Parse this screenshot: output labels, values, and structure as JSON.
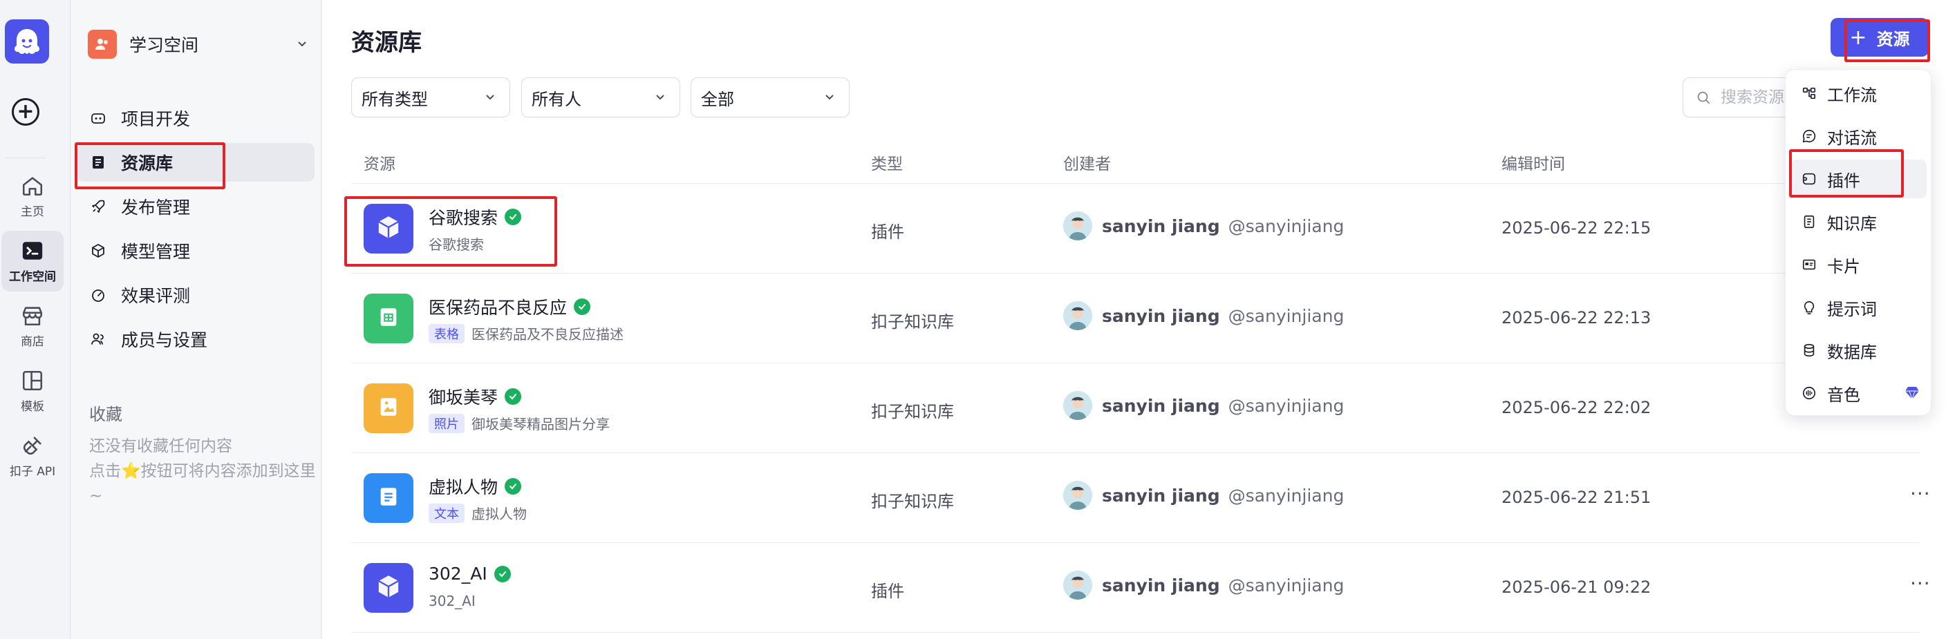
{
  "rail": {
    "items": [
      {
        "label": "主页",
        "icon": "home-icon"
      },
      {
        "label": "工作空间",
        "icon": "terminal-icon"
      },
      {
        "label": "商店",
        "icon": "store-icon"
      },
      {
        "label": "模板",
        "icon": "template-icon"
      },
      {
        "label": "扣子 API",
        "icon": "plug-icon"
      }
    ]
  },
  "sidebar": {
    "workspace": "学习空间",
    "nav": [
      {
        "label": "项目开发",
        "icon": "bot-icon"
      },
      {
        "label": "资源库",
        "icon": "library-icon"
      },
      {
        "label": "发布管理",
        "icon": "rocket-icon"
      },
      {
        "label": "模型管理",
        "icon": "cube-icon"
      },
      {
        "label": "效果评测",
        "icon": "gauge-icon"
      },
      {
        "label": "成员与设置",
        "icon": "members-icon"
      }
    ],
    "favorites_title": "收藏",
    "favorites_empty_1": "还没有收藏任何内容",
    "favorites_empty_2": "点击⭐按钮可将内容添加到这里~"
  },
  "main": {
    "title": "资源库",
    "add_button": "资源",
    "filters": [
      "所有类型",
      "所有人",
      "全部"
    ],
    "search_placeholder": "搜索资源",
    "columns": [
      "资源",
      "类型",
      "创建者",
      "编辑时间"
    ],
    "rows": [
      {
        "name": "谷歌搜索",
        "tag": "",
        "desc": "谷歌搜索",
        "type": "插件",
        "user": "sanyin jiang",
        "handle": "@sanyinjiang",
        "time": "2025-06-22 22:15",
        "color": "#4d53e8",
        "icon": "cube-icon"
      },
      {
        "name": "医保药品不良反应",
        "tag": "表格",
        "desc": "医保药品及不良反应描述",
        "type": "扣子知识库",
        "user": "sanyin jiang",
        "handle": "@sanyinjiang",
        "time": "2025-06-22 22:13",
        "color": "#38c172",
        "icon": "table-icon"
      },
      {
        "name": "御坂美琴",
        "tag": "照片",
        "desc": "御坂美琴精品图片分享",
        "type": "扣子知识库",
        "user": "sanyin jiang",
        "handle": "@sanyinjiang",
        "time": "2025-06-22 22:02",
        "color": "#f7b23b",
        "icon": "image-icon"
      },
      {
        "name": "虚拟人物",
        "tag": "文本",
        "desc": "虚拟人物",
        "type": "扣子知识库",
        "user": "sanyin jiang",
        "handle": "@sanyinjiang",
        "time": "2025-06-22 21:51",
        "color": "#2f8cf5",
        "icon": "document-icon"
      },
      {
        "name": "302_AI",
        "tag": "",
        "desc": "302_AI",
        "type": "插件",
        "user": "sanyin jiang",
        "handle": "@sanyinjiang",
        "time": "2025-06-21 09:22",
        "color": "#4d53e8",
        "icon": "cube-icon"
      }
    ],
    "more_label": "···"
  },
  "menu": {
    "items": [
      {
        "label": "工作流",
        "icon": "workflow-icon"
      },
      {
        "label": "对话流",
        "icon": "chatflow-icon"
      },
      {
        "label": "插件",
        "icon": "plugin-icon"
      },
      {
        "label": "知识库",
        "icon": "knowledge-icon"
      },
      {
        "label": "卡片",
        "icon": "card-icon"
      },
      {
        "label": "提示词",
        "icon": "prompt-icon"
      },
      {
        "label": "数据库",
        "icon": "database-icon"
      },
      {
        "label": "音色",
        "icon": "voice-icon"
      }
    ]
  },
  "colors": {
    "accent": "#4d53e8",
    "annotation": "#e0242a",
    "success": "#1bb05f"
  }
}
